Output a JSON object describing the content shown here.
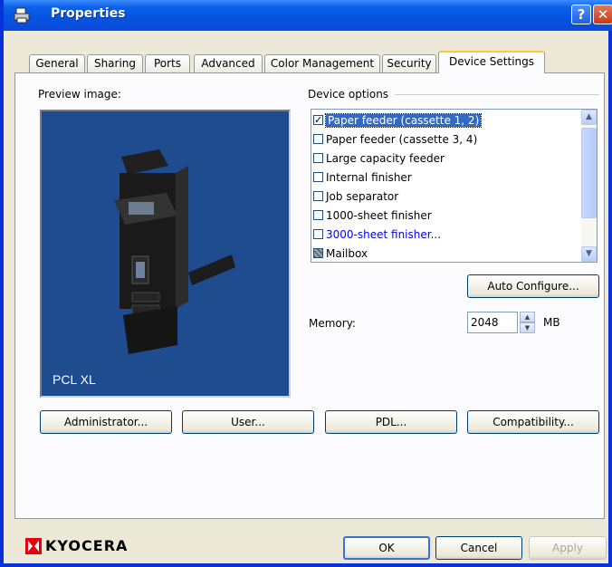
{
  "window": {
    "title": "Properties",
    "help_glyph": "?",
    "close_glyph": "✕"
  },
  "tabs": [
    {
      "label": "General"
    },
    {
      "label": "Sharing"
    },
    {
      "label": "Ports"
    },
    {
      "label": "Advanced"
    },
    {
      "label": "Color Management"
    },
    {
      "label": "Security"
    },
    {
      "label": "Device Settings",
      "active": true
    }
  ],
  "preview": {
    "label": "Preview image:",
    "overlay": "PCL XL"
  },
  "device_options": {
    "label": "Device options",
    "items": [
      {
        "text": "Paper feeder (cassette 1, 2)",
        "state": "checked",
        "selected": true
      },
      {
        "text": "Paper feeder (cassette 3, 4)",
        "state": "unchecked"
      },
      {
        "text": "Large capacity feeder",
        "state": "unchecked"
      },
      {
        "text": "Internal finisher",
        "state": "unchecked"
      },
      {
        "text": "Job separator",
        "state": "unchecked"
      },
      {
        "text": "1000-sheet finisher",
        "state": "unchecked"
      },
      {
        "text": "3000-sheet finisher...",
        "state": "unchecked",
        "link": true
      },
      {
        "text": "Mailbox",
        "state": "indeterminate"
      }
    ]
  },
  "buttons": {
    "auto_configure": "Auto Configure...",
    "administrator": "Administrator...",
    "user": "User...",
    "pdl": "PDL...",
    "compatibility": "Compatibility...",
    "ok": "OK",
    "cancel": "Cancel",
    "apply": "Apply"
  },
  "memory": {
    "label": "Memory:",
    "value": "2048",
    "unit": "MB"
  },
  "brand": {
    "name": "KYOCERA",
    "color": "#e60012"
  },
  "colors": {
    "titlebar": "#0a5fe8",
    "selection": "#316ac5",
    "preview_bg": "#1f4b8f",
    "tab_highlight": "#ffc83c"
  }
}
